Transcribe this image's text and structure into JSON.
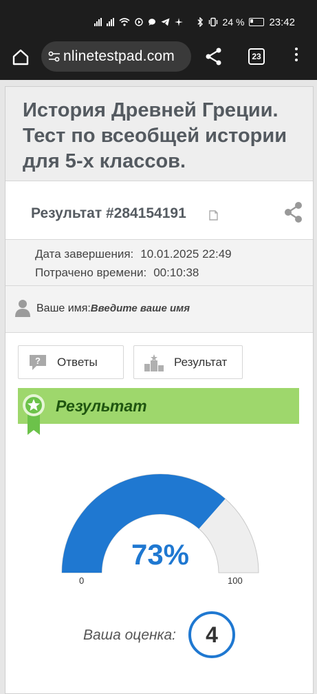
{
  "status_bar": {
    "battery": "24 %",
    "time": "23:42"
  },
  "browser": {
    "url": "nlinetestpad.com",
    "tab_count": "23"
  },
  "page": {
    "title": "История Древней Греции. Тест по всеобщей истории для 5-х классов.",
    "result_title": "Результат #284154191",
    "meta": {
      "completed_label": "Дата завершения:",
      "completed_value": "10.01.2025 22:49",
      "spent_label": "Потрачено времени:",
      "spent_value": "00:10:38"
    },
    "name": {
      "label": "Ваше имя:",
      "prompt": "Введите ваше имя"
    },
    "buttons": {
      "answers": "Ответы",
      "result": "Результат"
    },
    "banner": "Результат",
    "gauge": {
      "percent": 73,
      "percent_text": "73%",
      "min": "0",
      "max": "100",
      "fill_color": "#1f78d1",
      "track_color": "#eeeeee"
    },
    "grade": {
      "label": "Ваша оценка:",
      "value": "4"
    }
  }
}
